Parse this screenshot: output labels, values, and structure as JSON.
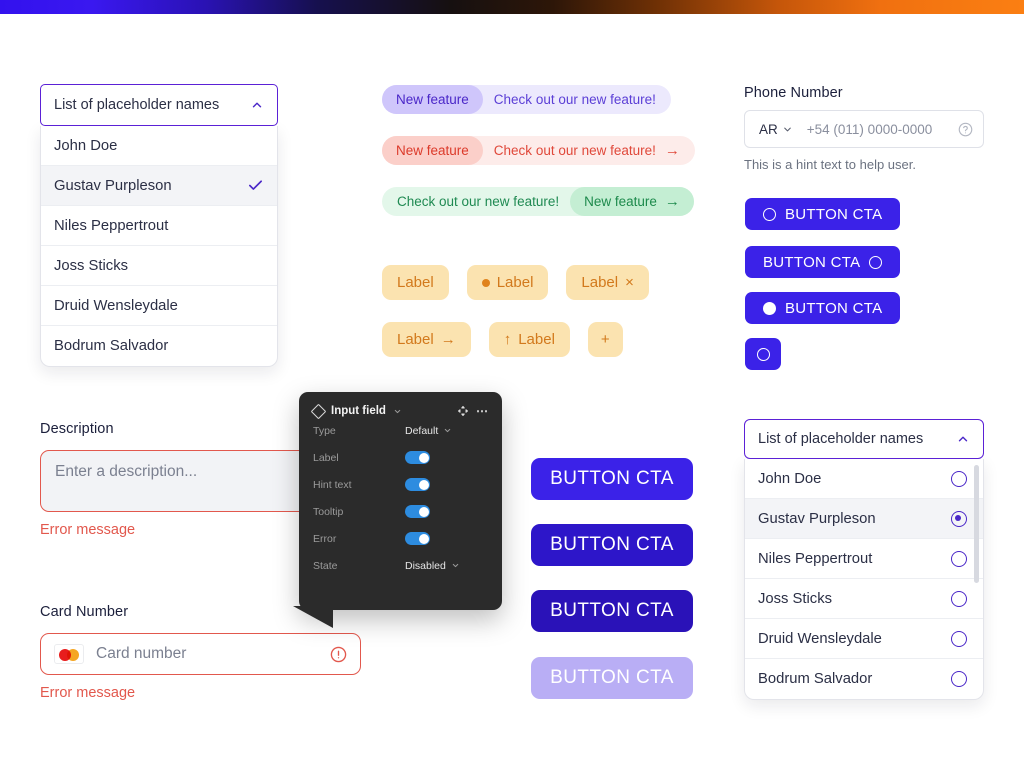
{
  "topbar": {
    "gradient_from": "#3311ee",
    "gradient_mid": "#161010",
    "gradient_to": "#fb7f12"
  },
  "dropdown_left": {
    "header_label": "List of placeholder names",
    "chevron_icon": "chevron-up-icon",
    "items": [
      {
        "label": "John Doe",
        "selected": false
      },
      {
        "label": "Gustav Purpleson",
        "selected": true
      },
      {
        "label": "Niles Peppertrout",
        "selected": false
      },
      {
        "label": "Joss Sticks",
        "selected": false
      },
      {
        "label": "Druid Wensleydale",
        "selected": false
      },
      {
        "label": "Bodrum Salvador",
        "selected": false
      }
    ],
    "check_icon": "check-icon"
  },
  "badges": [
    {
      "variant": "purple",
      "pill": "New feature",
      "text": "Check out our new feature!",
      "arrow": "",
      "pill_first": true,
      "pill_bg": "#cfc6fb",
      "row_bg": "#ece9fd"
    },
    {
      "variant": "red",
      "pill": "New feature",
      "text": "Check out our new feature!",
      "arrow": "→",
      "pill_first": true,
      "pill_bg": "#fbcfc9",
      "row_bg": "#fdecea"
    },
    {
      "variant": "green",
      "pill": "New feature",
      "text": "Check out our new feature!",
      "arrow": "→",
      "pill_first": false,
      "pill_bg": "#c4eed3",
      "row_bg": "#e3f7ea"
    }
  ],
  "chips": {
    "color_bg": "#fbe3b0",
    "color_fg": "#d2791c",
    "row1": [
      {
        "label": "Label",
        "leading": "none",
        "trailing": "none"
      },
      {
        "label": "Label",
        "leading": "dot",
        "trailing": "none"
      },
      {
        "label": "Label",
        "leading": "none",
        "trailing": "×"
      }
    ],
    "row2": [
      {
        "label": "Label",
        "leading": "none",
        "trailing": "→"
      },
      {
        "label": "Label",
        "leading": "↑",
        "trailing": "none"
      },
      {
        "label": "+",
        "leading": "none",
        "trailing": "none"
      }
    ]
  },
  "phone": {
    "label": "Phone Number",
    "country_code": "AR",
    "country_chevron": "chevron-down-icon",
    "placeholder": "+54 (011) 0000-0000",
    "help_icon": "question-circle-icon",
    "hint": "This is a hint text to help user."
  },
  "right_buttons": [
    {
      "label": "BUTTON CTA",
      "icon": "circle-outline-icon",
      "icon_side": "left",
      "bg": "#3b22e8"
    },
    {
      "label": "BUTTON CTA",
      "icon": "circle-outline-icon",
      "icon_side": "right",
      "bg": "#3b22e8"
    },
    {
      "label": "BUTTON CTA",
      "icon": "circle-filled-icon",
      "icon_side": "left",
      "bg": "#3b22e8"
    },
    {
      "label": "",
      "icon": "circle-outline-icon",
      "icon_side": "only",
      "bg": "#3b22e8"
    }
  ],
  "middle_buttons": [
    {
      "label": "BUTTON CTA",
      "bg": "#3b22e8",
      "state": "default"
    },
    {
      "label": "BUTTON CTA",
      "bg": "#2d16c9",
      "state": "hover"
    },
    {
      "label": "BUTTON CTA",
      "bg": "#2a12b8",
      "state": "pressed"
    },
    {
      "label": "BUTTON CTA",
      "bg": "#b9aef5",
      "state": "disabled"
    }
  ],
  "description": {
    "label": "Description",
    "placeholder": "Enter a description...",
    "error": "Error message"
  },
  "card": {
    "label": "Card Number",
    "brand_icon": "mastercard-icon",
    "placeholder": "Card number",
    "alert_icon": "alert-circle-icon",
    "error": "Error message"
  },
  "panel": {
    "title": "Input field",
    "title_icon": "diamond-icon",
    "title_chevron": "chevron-down-icon",
    "move_icon": "move-icon",
    "more_icon": "more-horizontal-icon",
    "rows": [
      {
        "key": "Type",
        "kind": "select",
        "value": "Default"
      },
      {
        "key": "Label",
        "kind": "toggle",
        "value": "on"
      },
      {
        "key": "Hint text",
        "kind": "toggle",
        "value": "on"
      },
      {
        "key": "Tooltip",
        "kind": "toggle",
        "value": "on"
      },
      {
        "key": "Error",
        "kind": "toggle",
        "value": "on"
      },
      {
        "key": "State",
        "kind": "select",
        "value": "Disabled"
      }
    ],
    "toggle_color": "#2d8ce0"
  },
  "dropdown_right": {
    "header_label": "List of placeholder names",
    "chevron_icon": "chevron-up-icon",
    "radio_color": "#4a27c8",
    "items": [
      {
        "label": "John Doe",
        "selected": false
      },
      {
        "label": "Gustav Purpleson",
        "selected": true
      },
      {
        "label": "Niles Peppertrout",
        "selected": false
      },
      {
        "label": "Joss Sticks",
        "selected": false
      },
      {
        "label": "Druid Wensleydale",
        "selected": false
      },
      {
        "label": "Bodrum Salvador",
        "selected": false
      }
    ]
  }
}
